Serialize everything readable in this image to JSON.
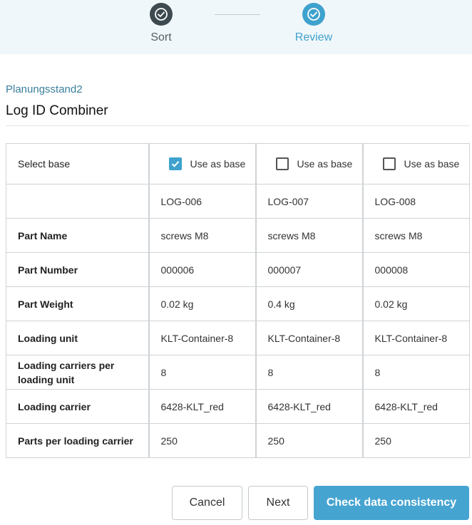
{
  "stepper": {
    "steps": [
      {
        "label": "Sort",
        "state": "done"
      },
      {
        "label": "Review",
        "state": "active"
      }
    ]
  },
  "breadcrumb": "Planungsstand2",
  "title": "Log ID Combiner",
  "table": {
    "select_label": "Select base",
    "use_as_base_label": "Use as base",
    "columns": [
      {
        "log_id": "LOG-006",
        "checked": true,
        "part_name": "screws M8",
        "part_number": "000006",
        "part_weight": "0.02 kg",
        "loading_unit": "KLT-Container-8",
        "carriers_per_unit": "8",
        "loading_carrier": "6428-KLT_red",
        "parts_per_carrier": "250"
      },
      {
        "log_id": "LOG-007",
        "checked": false,
        "part_name": "screws M8",
        "part_number": "000007",
        "part_weight": "0.4 kg",
        "loading_unit": "KLT-Container-8",
        "carriers_per_unit": "8",
        "loading_carrier": "6428-KLT_red",
        "parts_per_carrier": "250"
      },
      {
        "log_id": "LOG-008",
        "checked": false,
        "part_name": "screws M8",
        "part_number": "000008",
        "part_weight": "0.02 kg",
        "loading_unit": "KLT-Container-8",
        "carriers_per_unit": "8",
        "loading_carrier": "6428-KLT_red",
        "parts_per_carrier": "250"
      }
    ],
    "row_headers": {
      "part_name": "Part Name",
      "part_number": "Part Number",
      "part_weight": "Part Weight",
      "loading_unit": "Loading unit",
      "carriers_per_unit": "Loading carriers per loading unit",
      "loading_carrier": "Loading carrier",
      "parts_per_carrier": "Parts per loading carrier"
    }
  },
  "buttons": {
    "cancel": "Cancel",
    "next": "Next",
    "check": "Check data consistency"
  },
  "colors": {
    "accent": "#3fa2cd",
    "primary_button": "#46a4d1",
    "stepper_bg": "#f0f7fa"
  }
}
